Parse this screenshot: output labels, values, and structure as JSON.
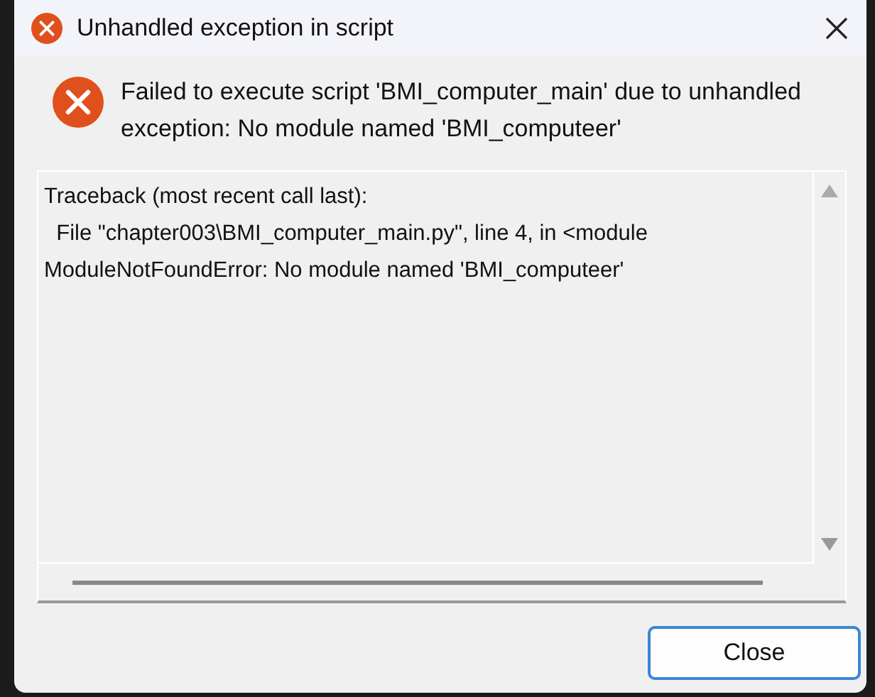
{
  "window": {
    "title": "Unhandled exception in script"
  },
  "message": "Failed to execute script 'BMI_computer_main' due to unhandled exception: No module named 'BMI_computeer'",
  "details": [
    "Traceback (most recent call last):",
    "  File \"chapter003\\BMI_computer_main.py\", line 4, in <module",
    "ModuleNotFoundError: No module named 'BMI_computeer'"
  ],
  "buttons": [
    "Close"
  ]
}
